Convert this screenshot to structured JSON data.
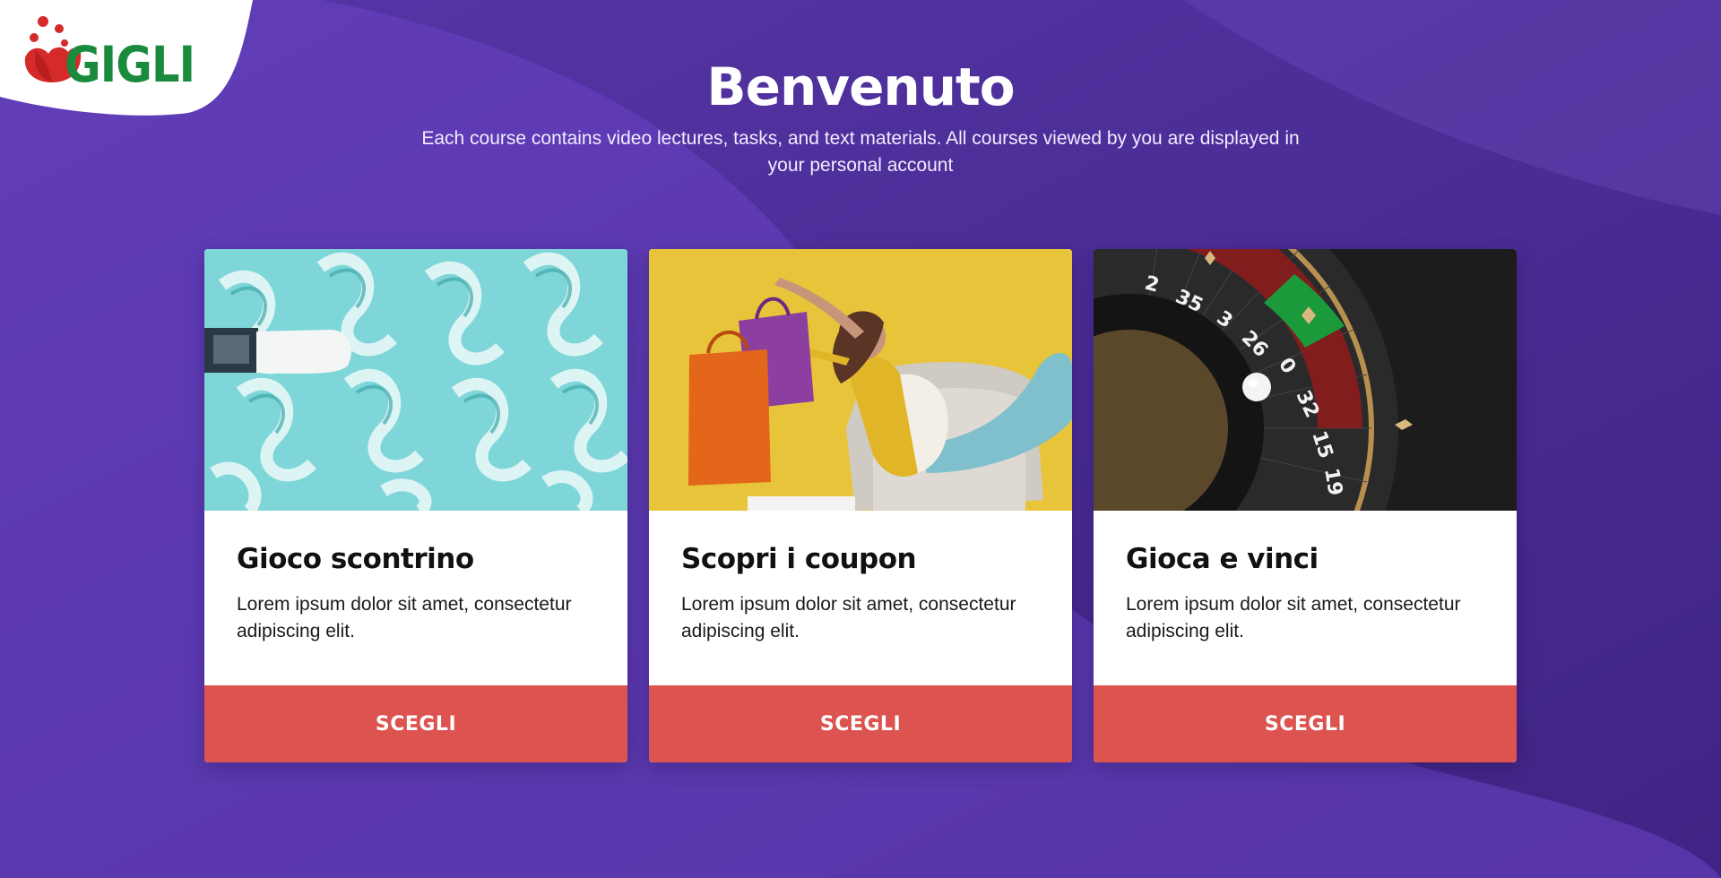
{
  "brand": {
    "logo_text": "GIGLI",
    "logo_green": "#1a8a3c",
    "logo_red": "#d42a2a"
  },
  "hero": {
    "title": "Benvenuto",
    "subtitle": "Each course contains video lectures, tasks, and text materials. All courses viewed by you are displayed in your personal account"
  },
  "colors": {
    "background": "#4a2d90",
    "accent_light": "#6a44c4",
    "button": "#dc5350",
    "card": "#ffffff"
  },
  "cards": [
    {
      "title": "Gioco scontrino",
      "description": "Lorem ipsum dolor sit amet, consectetur adipiscing elit.",
      "button": "SCEGLI",
      "image": "receipt-paper-image"
    },
    {
      "title": "Scopri i coupon",
      "description": "Lorem ipsum dolor sit amet, consectetur adipiscing elit.",
      "button": "SCEGLI",
      "image": "shopping-woman-image"
    },
    {
      "title": "Gioca e vinci",
      "description": "Lorem ipsum dolor sit amet, consectetur adipiscing elit.",
      "button": "SCEGLI",
      "image": "roulette-wheel-image"
    }
  ]
}
